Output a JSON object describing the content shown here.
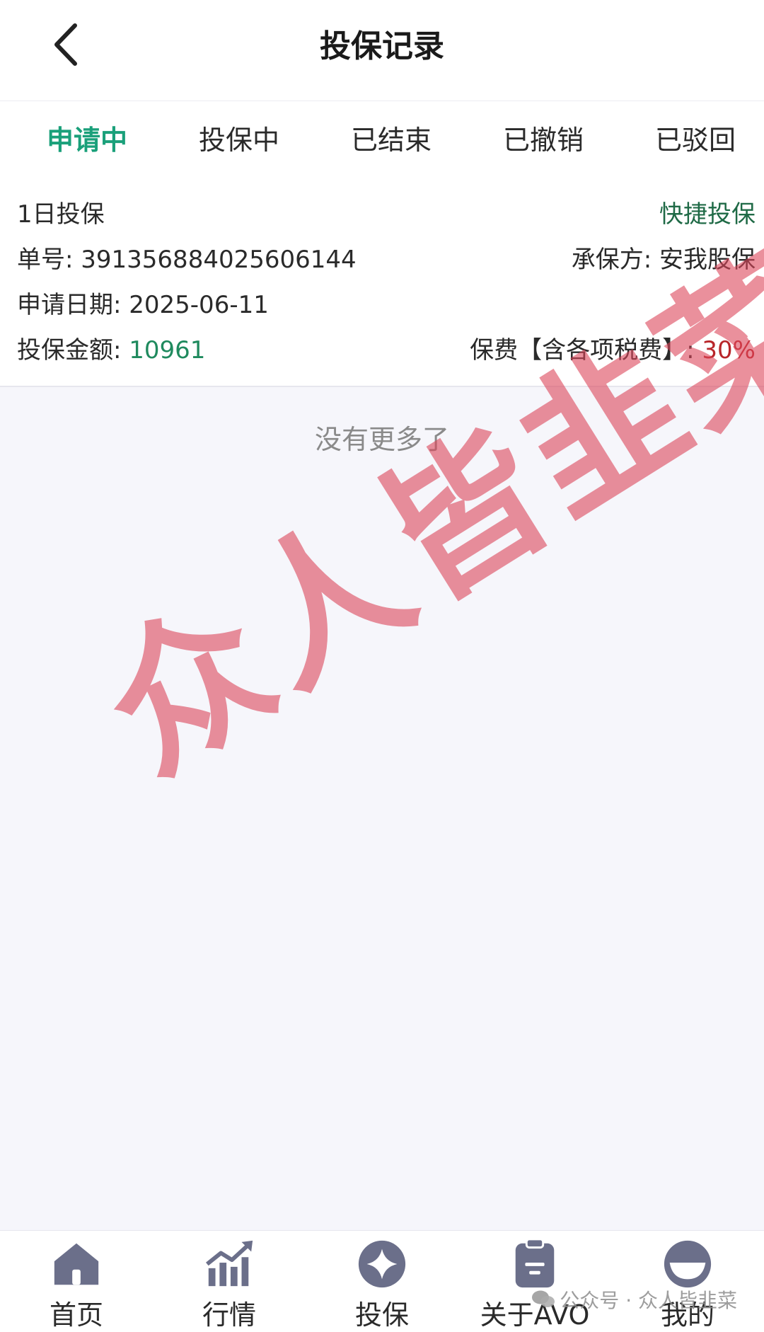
{
  "header": {
    "title": "投保记录"
  },
  "tabs": [
    {
      "label": "申请中",
      "active": true
    },
    {
      "label": "投保中",
      "active": false
    },
    {
      "label": "已结束",
      "active": false
    },
    {
      "label": "已撤销",
      "active": false
    },
    {
      "label": "已驳回",
      "active": false
    }
  ],
  "record": {
    "plan": "1日投保",
    "quick_link": "快捷投保",
    "order_label": "单号: ",
    "order_no": "391356884025606144",
    "underwriter_label": "承保方: ",
    "underwriter": "安我股保",
    "date_label": "申请日期: ",
    "date": "2025-06-11",
    "amount_label": "投保金额: ",
    "amount": "10961",
    "fee_label": "保费【含各项税费】: ",
    "fee": "30%"
  },
  "list_end": "没有更多了",
  "stamp": "众人皆韭菜",
  "nav": [
    {
      "label": "首页",
      "icon": "home-icon"
    },
    {
      "label": "行情",
      "icon": "market-chart-icon"
    },
    {
      "label": "投保",
      "icon": "insure-star-icon"
    },
    {
      "label": "关于AVO",
      "icon": "clipboard-icon"
    },
    {
      "label": "我的",
      "icon": "profile-icon"
    }
  ],
  "wechat_watermark": "公众号 · 众人皆韭菜",
  "colors": {
    "accent": "#1aa07a",
    "fee_red": "#b8262a",
    "stamp": "#dc465a",
    "nav_icon": "#6b6f8a"
  }
}
